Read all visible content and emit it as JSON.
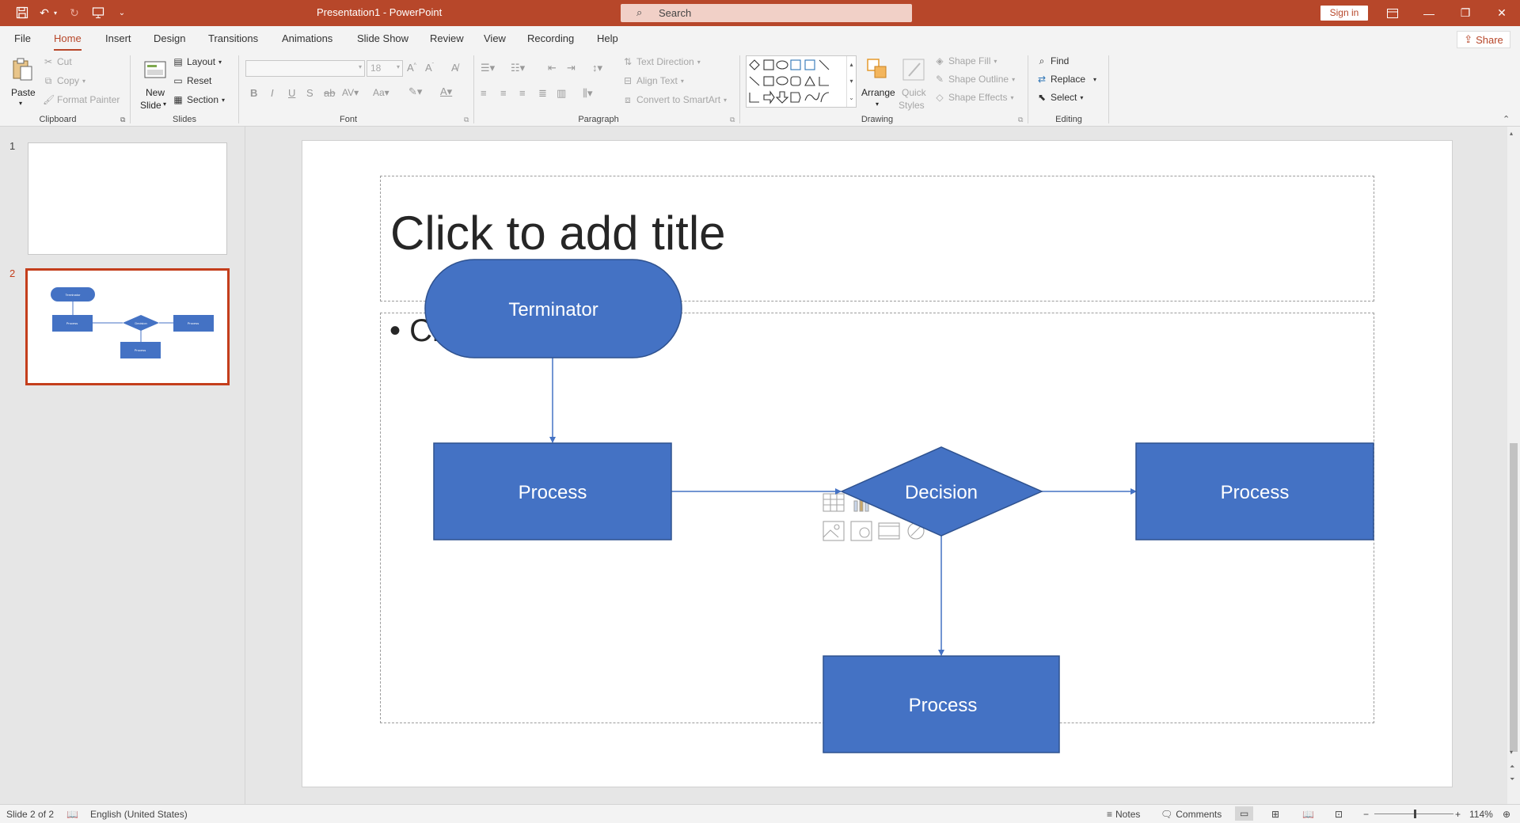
{
  "window": {
    "title": "Presentation1  -  PowerPoint",
    "search_placeholder": "Search",
    "sign_in": "Sign in"
  },
  "tabs": [
    "File",
    "Home",
    "Insert",
    "Design",
    "Transitions",
    "Animations",
    "Slide Show",
    "Review",
    "View",
    "Recording",
    "Help"
  ],
  "share_label": "Share",
  "ribbon": {
    "clipboard": {
      "label": "Clipboard",
      "paste": "Paste",
      "cut": "Cut",
      "copy": "Copy",
      "format_painter": "Format Painter"
    },
    "slides": {
      "label": "Slides",
      "new_slide_1": "New",
      "new_slide_2": "Slide",
      "layout": "Layout",
      "reset": "Reset",
      "section": "Section"
    },
    "font": {
      "label": "Font",
      "font_size": "18"
    },
    "paragraph": {
      "label": "Paragraph",
      "text_direction": "Text Direction",
      "align_text": "Align Text",
      "convert_smartart": "Convert to SmartArt"
    },
    "drawing": {
      "label": "Drawing",
      "arrange": "Arrange",
      "quick_styles_1": "Quick",
      "quick_styles_2": "Styles",
      "shape_fill": "Shape Fill",
      "shape_outline": "Shape Outline",
      "shape_effects": "Shape Effects"
    },
    "editing": {
      "label": "Editing",
      "find": "Find",
      "replace": "Replace",
      "select": "Select"
    }
  },
  "thumbnails": [
    {
      "number": "1"
    },
    {
      "number": "2",
      "shapes": {
        "terminator": "Terminator",
        "process_left": "Process",
        "decision": "Decision",
        "process_right": "Process",
        "process_bottom": "Process"
      }
    }
  ],
  "slide": {
    "title_placeholder": "Click to add title",
    "content_placeholder_visible": "Cl",
    "shapes": {
      "terminator": "Terminator",
      "process_left": "Process",
      "decision": "Decision",
      "process_right": "Process",
      "process_bottom": "Process"
    },
    "shape_fill": "#4472c4",
    "shape_stroke": "#2f528f"
  },
  "status": {
    "slide_count": "Slide 2 of 2",
    "language": "English (United States)",
    "notes": "Notes",
    "comments": "Comments",
    "zoom": "114%"
  },
  "colors": {
    "accent": "#b7472a",
    "selection": "#c43e1c"
  }
}
